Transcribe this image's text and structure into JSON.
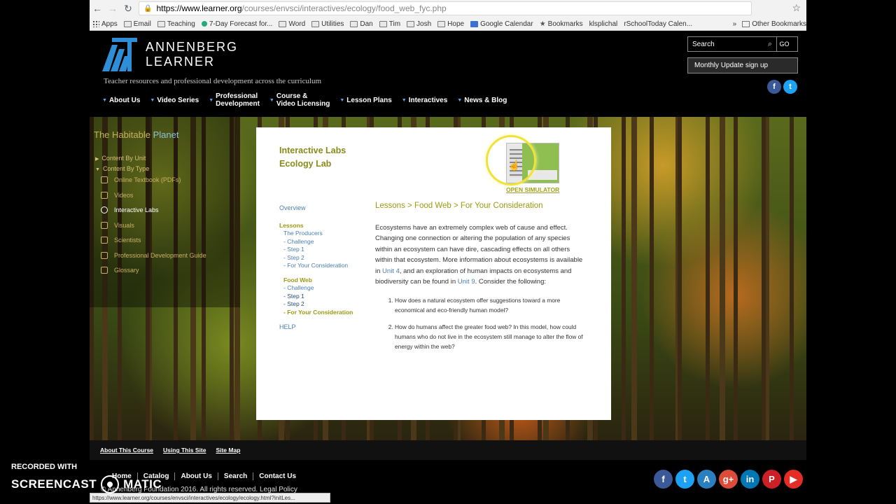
{
  "browser": {
    "url_host": "https://www.learner.org",
    "url_path": "/courses/envsci/interactives/ecology/food_web_fyc.php",
    "bookmarks": [
      "Apps",
      "Email",
      "Teaching",
      "7-Day Forecast for...",
      "Word",
      "Utilities",
      "Dan",
      "Tim",
      "Josh",
      "Hope",
      "Google Calendar",
      "Bookmarks",
      "klsplichal",
      "rSchoolToday Calen..."
    ],
    "other_bookmarks": "Other Bookmarks",
    "status_url": "https://www.learner.org/courses/envsci/interactives/ecology/ecology.html?initLes..."
  },
  "header": {
    "logo_line1": "ANNENBERG",
    "logo_line2": "LEARNER",
    "tagline": "Teacher resources and professional development across the curriculum",
    "search_placeholder": "Search",
    "go_label": "GO",
    "monthly_label": "Monthly Update sign up"
  },
  "nav": [
    "About Us",
    "Video Series",
    "Professional\nDevelopment",
    "Course &\nVideo Licensing",
    "Lesson Plans",
    "Interactives",
    "News & Blog"
  ],
  "sidebar": {
    "title_a": "The Habitable",
    "title_b": "Planet",
    "content_by_unit": "Content By Unit",
    "content_by_type": "Content By Type",
    "items": [
      "Online Textbook (PDFs)",
      "Videos",
      "Interactive Labs",
      "Visuals",
      "Scientists",
      "Professional Development Guide",
      "Glossary"
    ]
  },
  "panel": {
    "lab_line1": "Interactive Labs",
    "lab_line2": "Ecology Lab",
    "open_simulator": "OPEN SIMULATOR",
    "overview": "Overview",
    "lessons": "Lessons",
    "producers": "The Producers",
    "producer_items": [
      "- Challenge",
      "- Step 1",
      "- Step 2",
      "- For Your Consideration"
    ],
    "food_web": "Food Web",
    "food_web_items": [
      "- Challenge",
      "- Step 1",
      "- Step 2",
      "- For Your Consideration"
    ],
    "help": "HELP",
    "breadcrumb": "Lessons > Food Web > For Your Consideration",
    "body_1": "Ecosystems have an extremely complex web of cause and effect. Changing one connection or altering the population of any species within an ecosystem can have dire, cascading effects on all others within that ecosystem. More information about ecosystems is available in ",
    "unit4": "Unit 4",
    "body_2": ", and an exploration of human impacts on ecosystems and biodiversity can be found in ",
    "unit9": "Unit 9",
    "body_3": ". Consider the following:",
    "questions": [
      "How does a natural ecosystem offer suggestions toward a more economical and eco-friendly human model?",
      "How do humans affect the greater food web? In this model, how could humans who do not live in the ecosystem still manage to alter the flow of energy within the web?"
    ]
  },
  "footer": {
    "links1": [
      "About This Course",
      "Using This Site",
      "Site Map"
    ],
    "links2": [
      "Home",
      "Catalog",
      "About Us",
      "Search",
      "Contact Us"
    ],
    "copyright": "© Annenberg Foundation 2016. All rights reserved. Legal Policy"
  },
  "watermark": {
    "line1": "RECORDED WITH",
    "left": "SCREENCAST",
    "right": "MATIC"
  },
  "colors": {
    "accent_blue": "#5aa8e8",
    "olive": "#9a9a10",
    "facebook": "#3b5998",
    "twitter": "#1da1f2",
    "google": "#dd4b39",
    "linkedin": "#0077b5",
    "pinterest": "#cb2027",
    "youtube": "#e52d27"
  }
}
